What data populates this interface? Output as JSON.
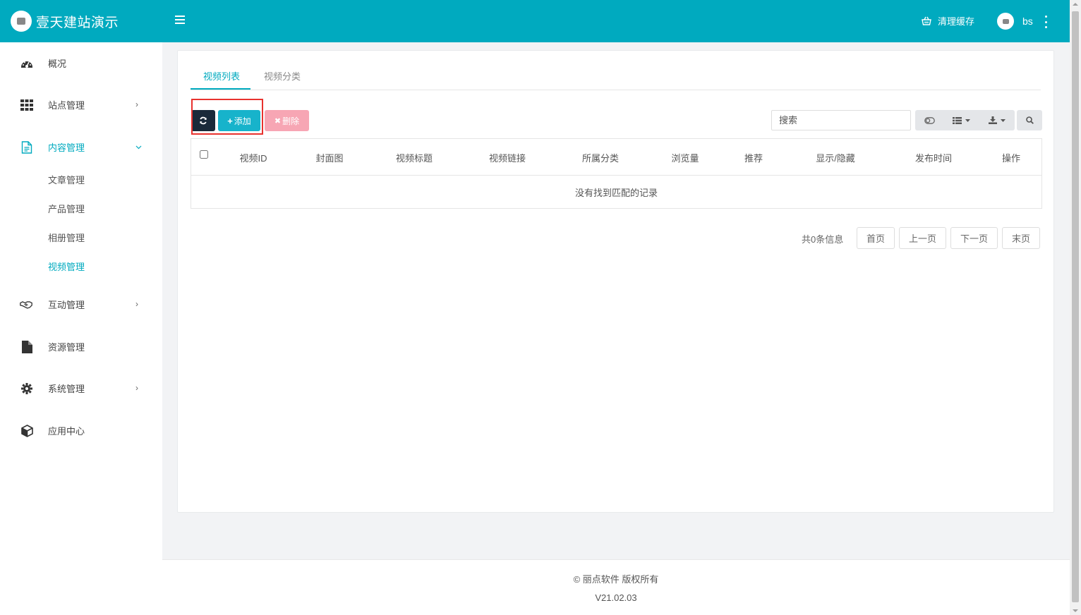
{
  "app": {
    "title": "壹天建站演示",
    "brand_color": "#00aabf"
  },
  "topbar": {
    "clear_cache": "清理缓存",
    "user_name": "bs"
  },
  "sidebar": {
    "items": [
      {
        "label": "概况",
        "icon": "dashboard-icon"
      },
      {
        "label": "站点管理",
        "icon": "grid-icon"
      },
      {
        "label": "内容管理",
        "icon": "document-icon"
      },
      {
        "label": "互动管理",
        "icon": "handshake-icon"
      },
      {
        "label": "资源管理",
        "icon": "file-icon"
      },
      {
        "label": "系统管理",
        "icon": "gear-icon"
      },
      {
        "label": "应用中心",
        "icon": "cube-icon"
      }
    ],
    "sub_items": [
      "文章管理",
      "产品管理",
      "相册管理",
      "视频管理"
    ],
    "active_item": "内容管理",
    "active_sub_item": "视频管理"
  },
  "tabs": [
    "视频列表",
    "视频分类"
  ],
  "toolbar": {
    "add_label": "添加",
    "delete_label": "删除",
    "search_placeholder": "搜索"
  },
  "table": {
    "columns": [
      "视频ID",
      "封面图",
      "视频标题",
      "视频链接",
      "所属分类",
      "浏览量",
      "推荐",
      "显示/隐藏",
      "发布时间",
      "操作"
    ],
    "empty_text": "没有找到匹配的记录"
  },
  "pagination": {
    "info": "共0条信息",
    "first": "首页",
    "prev": "上一页",
    "next": "下一页",
    "last": "末页"
  },
  "footer": {
    "copyright": "© 丽点软件 版权所有",
    "version": "V21.02.03"
  }
}
